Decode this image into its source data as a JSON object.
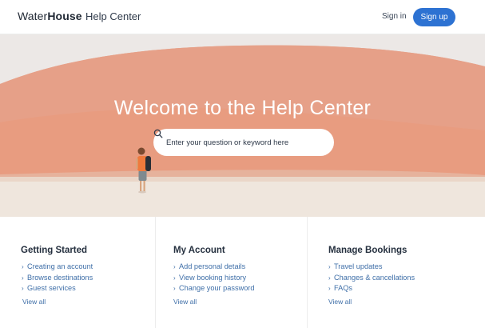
{
  "header": {
    "logo_part1": "Water",
    "logo_part2": "House",
    "subtitle": "Help Center",
    "signin_label": "Sign in",
    "signup_label": "Sign up"
  },
  "hero": {
    "title": "Welcome to the Help Center",
    "search_placeholder": "Enter your question or keyword here",
    "search_icon": "search-icon"
  },
  "sections": [
    {
      "title": "Getting Started",
      "links": [
        "Creating an account",
        "Browse destinations",
        "Guest services"
      ],
      "view_all": "View all"
    },
    {
      "title": "My Account",
      "links": [
        "Add personal details",
        "View booking history",
        "Change your password"
      ],
      "view_all": "View all"
    },
    {
      "title": "Manage Bookings",
      "links": [
        "Travel updates",
        "Changes & cancellations",
        "FAQs"
      ],
      "view_all": "View all"
    }
  ],
  "colors": {
    "accent": "#2d72d2",
    "link": "#3f6fa8",
    "hero_sand": "#e99f85"
  }
}
